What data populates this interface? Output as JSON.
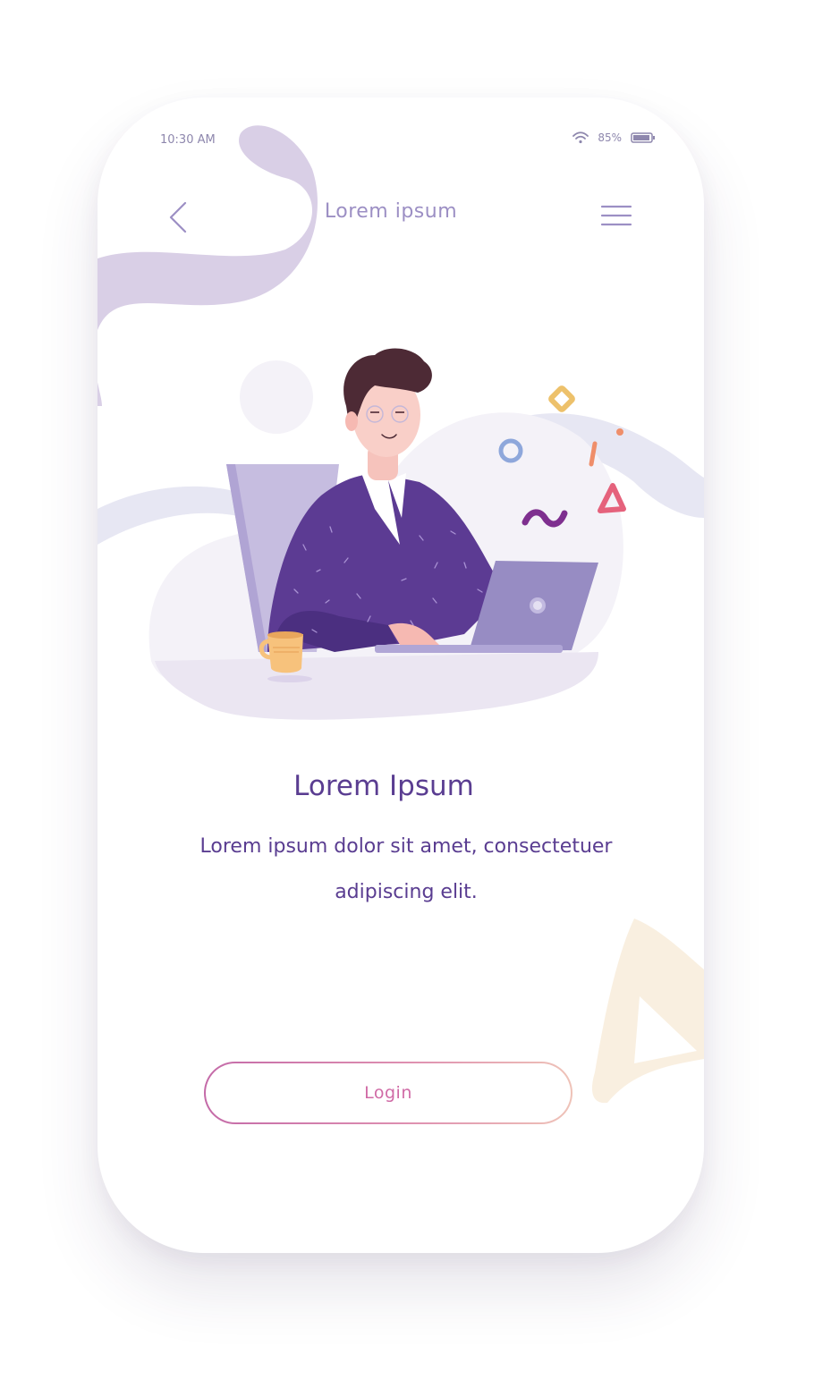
{
  "status_bar": {
    "time": "10:30 AM",
    "battery_percent": "85%",
    "wifi_icon": "wifi-icon",
    "battery_icon": "battery-icon"
  },
  "header": {
    "title": "Lorem ipsum",
    "back_icon": "chevron-left-icon",
    "menu_icon": "hamburger-menu-icon"
  },
  "content": {
    "title": "Lorem Ipsum",
    "description": "Lorem ipsum dolor sit amet, consectetuer adipiscing elit."
  },
  "actions": {
    "login_label": "Login"
  },
  "colors": {
    "primary_text": "#5a3d91",
    "header_text": "#9c8fc4",
    "accent_pink": "#d06ba6",
    "blob_purple": "#d9cfe6",
    "blob_blue": "#e7e7f3",
    "triangle_peach": "#f9efe0",
    "suit_purple": "#5c3b93"
  }
}
